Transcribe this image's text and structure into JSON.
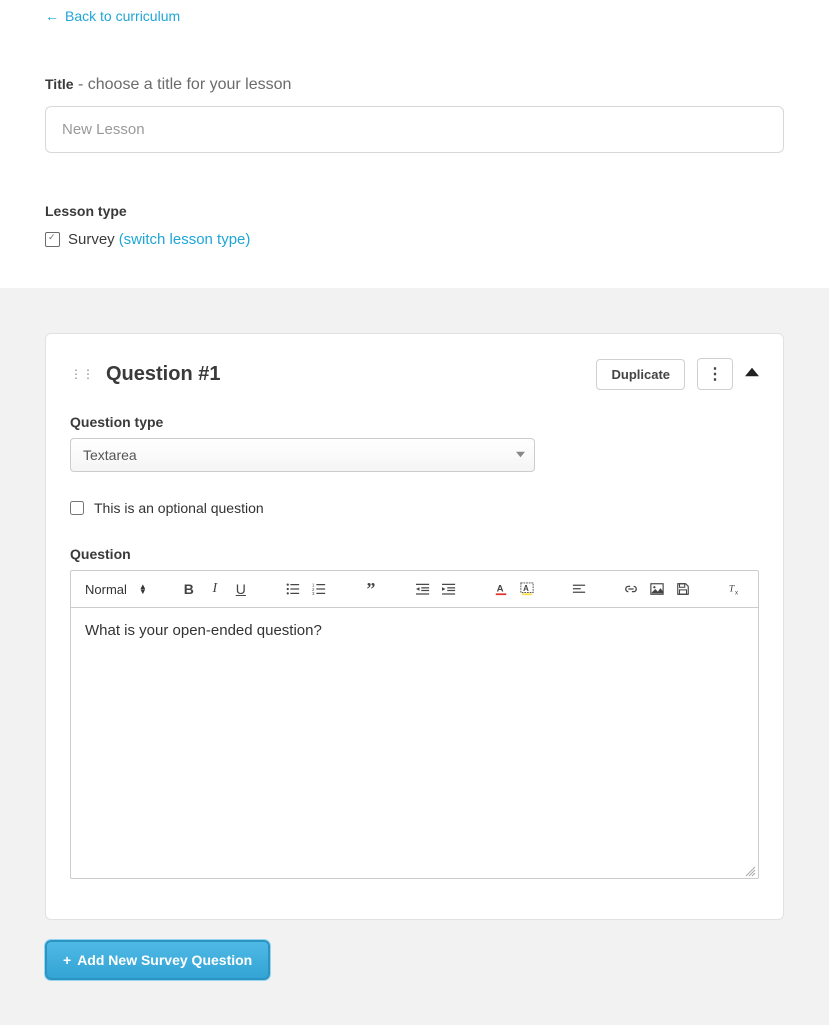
{
  "back_link": "Back to curriculum",
  "title_section": {
    "label": "Title",
    "hint": " - choose a title for your lesson",
    "value": "New Lesson"
  },
  "lesson_type_section": {
    "label": "Lesson type",
    "value": "Survey",
    "switch_link": "(switch lesson type)"
  },
  "question": {
    "title": "Question #1",
    "duplicate_label": "Duplicate",
    "type_label": "Question type",
    "type_value": "Textarea",
    "optional_label": "This is an optional question",
    "content_label": "Question",
    "content_text": "What is your open-ended question?"
  },
  "editor_toolbar": {
    "format_label": "Normal"
  },
  "add_button_label": "Add New Survey Question"
}
